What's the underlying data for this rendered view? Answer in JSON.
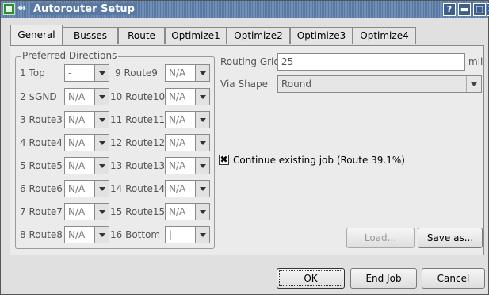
{
  "window": {
    "title": "Autorouter Setup",
    "help_label": "?",
    "min_label": "▬",
    "max_label": "□",
    "close_label": "✕"
  },
  "tabs": [
    {
      "label": "General"
    },
    {
      "label": "Busses"
    },
    {
      "label": "Route"
    },
    {
      "label": "Optimize1"
    },
    {
      "label": "Optimize2"
    },
    {
      "label": "Optimize3"
    },
    {
      "label": "Optimize4"
    }
  ],
  "preferred": {
    "title": "Preferred Directions",
    "left": [
      {
        "label": "1 Top",
        "value": "-"
      },
      {
        "label": "2 $GND",
        "value": "N/A"
      },
      {
        "label": "3 Route3",
        "value": "N/A"
      },
      {
        "label": "4 Route4",
        "value": "N/A"
      },
      {
        "label": "5 Route5",
        "value": "N/A"
      },
      {
        "label": "6 Route6",
        "value": "N/A"
      },
      {
        "label": "7 Route7",
        "value": "N/A"
      },
      {
        "label": "8 Route8",
        "value": "N/A"
      }
    ],
    "right": [
      {
        "label": "9 Route9",
        "value": "N/A"
      },
      {
        "label": "10 Route10",
        "value": "N/A"
      },
      {
        "label": "11 Route11",
        "value": "N/A"
      },
      {
        "label": "12 Route12",
        "value": "N/A"
      },
      {
        "label": "13 Route13",
        "value": "N/A"
      },
      {
        "label": "14 Route14",
        "value": "N/A"
      },
      {
        "label": "15 Route15",
        "value": "N/A"
      },
      {
        "label": "16 Bottom",
        "value": "|"
      }
    ]
  },
  "routing_grid": {
    "label": "Routing Grid",
    "value": "25",
    "unit": "mil"
  },
  "via_shape": {
    "label": "Via Shape",
    "value": "Round"
  },
  "continue_job": {
    "label": "Continue existing job (Route 39.1%)",
    "mark": "✖"
  },
  "buttons": {
    "load": "Load...",
    "save_as": "Save as...",
    "ok": "OK",
    "end_job": "End Job",
    "cancel": "Cancel"
  },
  "colors": {
    "titlebar": "#5978a3",
    "window_bg": "#e0e0e0",
    "panel_bg": "#ebebeb"
  }
}
